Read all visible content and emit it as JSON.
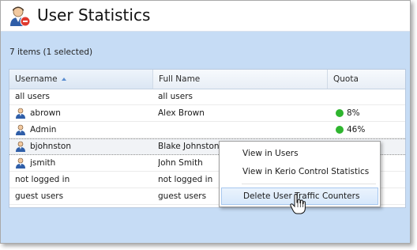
{
  "window": {
    "title": "User Statistics"
  },
  "toolbar": {
    "items_count": "7 items (1 selected)"
  },
  "grid": {
    "columns": [
      "Username",
      "Full Name",
      "Quota"
    ],
    "sort_column": "Username",
    "sort_direction": "ascending",
    "rows": [
      {
        "username": "all users",
        "full_name": "all users",
        "quota": "",
        "icon": false,
        "selected": false
      },
      {
        "username": "abrown",
        "full_name": "Alex Brown",
        "quota": "8%",
        "icon": true,
        "selected": false
      },
      {
        "username": "Admin",
        "full_name": "",
        "quota": "46%",
        "icon": true,
        "selected": false
      },
      {
        "username": "bjohnston",
        "full_name": "Blake Johnston",
        "quota": "",
        "icon": true,
        "selected": true
      },
      {
        "username": "jsmith",
        "full_name": "John Smith",
        "quota": "",
        "icon": true,
        "selected": false
      },
      {
        "username": "not logged in",
        "full_name": "not logged in",
        "quota": "",
        "icon": false,
        "selected": false
      },
      {
        "username": "guest users",
        "full_name": "guest users",
        "quota": "",
        "icon": false,
        "selected": false
      }
    ]
  },
  "context_menu": {
    "items": [
      {
        "label": "View in Users",
        "highlighted": false
      },
      {
        "label": "View in Kerio Control Statistics",
        "highlighted": false
      },
      {
        "label": "Delete User Traffic Counters",
        "highlighted": true
      }
    ]
  },
  "colors": {
    "accent": "#c6dcf5",
    "quota_ok": "#2fb52f",
    "header_bg": "#ffffff"
  },
  "icons": {
    "app": "user-statistics-icon",
    "user": "user-icon",
    "cursor": "hand-pointer-icon"
  }
}
